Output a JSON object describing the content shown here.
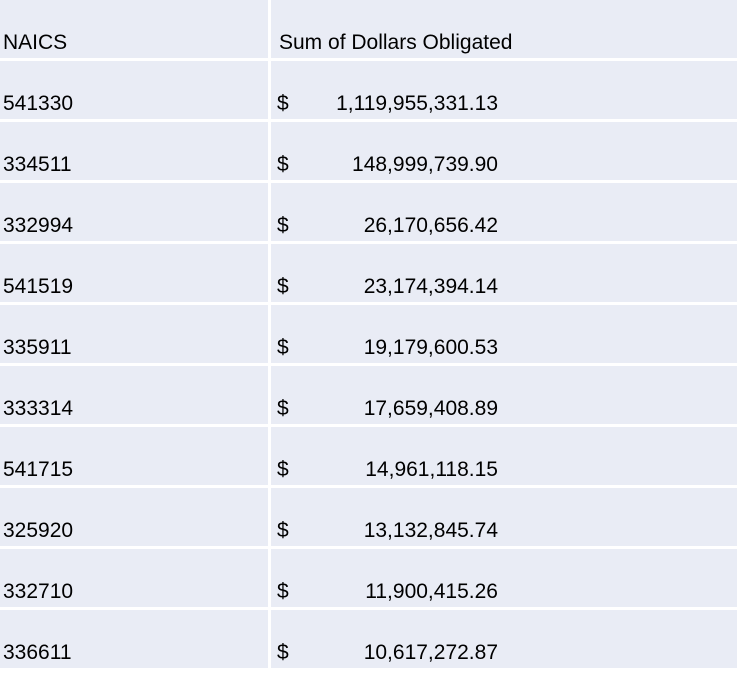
{
  "table": {
    "headers": [
      "NAICS",
      "Sum of Dollars Obligated"
    ],
    "currency_symbol": "$",
    "rows": [
      {
        "naics": "541330",
        "amount": "1,119,955,331.13"
      },
      {
        "naics": "334511",
        "amount": "148,999,739.90"
      },
      {
        "naics": "332994",
        "amount": "26,170,656.42"
      },
      {
        "naics": "541519",
        "amount": "23,174,394.14"
      },
      {
        "naics": "335911",
        "amount": "19,179,600.53"
      },
      {
        "naics": "333314",
        "amount": "17,659,408.89"
      },
      {
        "naics": "541715",
        "amount": "14,961,118.15"
      },
      {
        "naics": "325920",
        "amount": "13,132,845.74"
      },
      {
        "naics": "332710",
        "amount": "11,900,415.26"
      },
      {
        "naics": "336611",
        "amount": "10,617,272.87"
      }
    ]
  },
  "colors": {
    "cell_bg": "#e9ecf5",
    "grid_line": "#ffffff",
    "text": "#000000"
  }
}
